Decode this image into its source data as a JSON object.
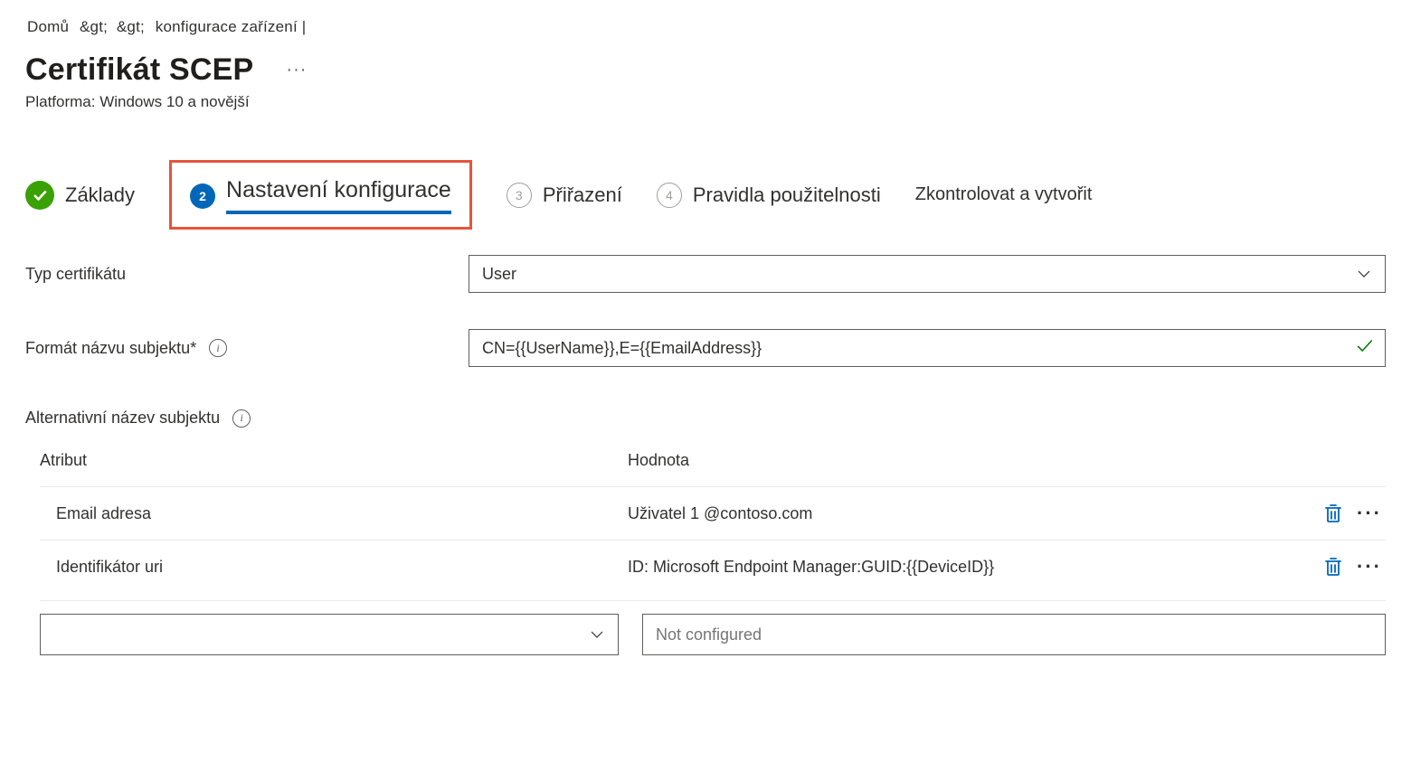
{
  "breadcrumb": {
    "home": "Domů",
    "sep": ">",
    "tail": "konfigurace zařízení |"
  },
  "title": "Certifikát SCEP",
  "subtitle": "Platforma: Windows 10 a novější",
  "wizard": {
    "step1": "Základy",
    "step2_num": "2",
    "step2": "Nastavení konfigurace",
    "step3_num": "3",
    "step3": "Přiřazení",
    "step4_num": "4",
    "step4": "Pravidla použitelnosti",
    "step5": "Zkontrolovat a vytvořit"
  },
  "fields": {
    "cert_type_label": "Typ certifikátu",
    "cert_type_value": "User",
    "subject_name_label": "Formát názvu subjektu*",
    "subject_name_value": "CN={{UserName}},E={{EmailAddress}}",
    "san_label": "Alternativní název subjektu"
  },
  "san_table": {
    "col_attr": "Atribut",
    "col_val": "Hodnota",
    "rows": [
      {
        "attr": "Email adresa",
        "val": "Uživatel 1 @contoso.com"
      },
      {
        "attr": "Identifikátor uri",
        "val": "ID: Microsoft Endpoint Manager:GUID:{{DeviceID}}"
      }
    ],
    "new_attr_placeholder": "",
    "new_val_placeholder": "Not configured"
  }
}
